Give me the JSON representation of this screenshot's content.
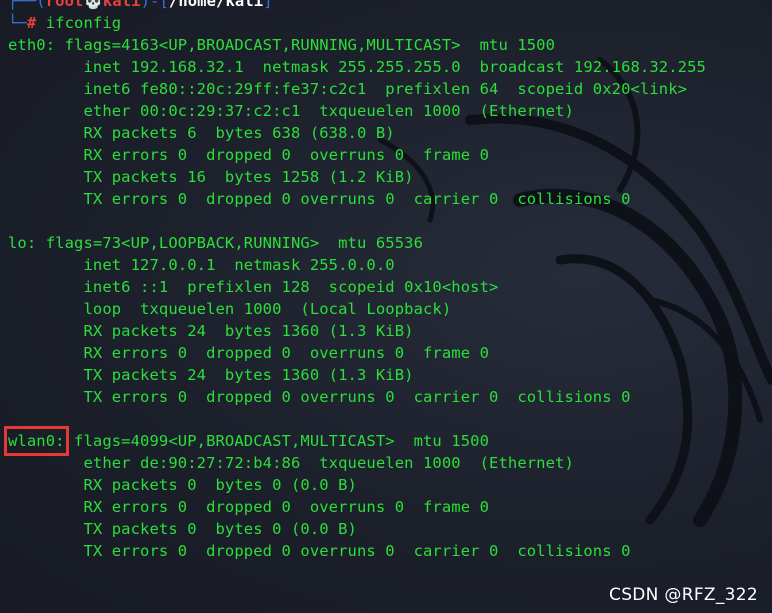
{
  "prompt": {
    "open": "┌──(",
    "user": "root💀kali",
    "mid": ")-[",
    "path": "/home/kali",
    "close": "]",
    "second_prefix": "└─",
    "hash": "#",
    "command": "ifconfig"
  },
  "output": {
    "eth0_header": "eth0: flags=4163<UP,BROADCAST,RUNNING,MULTICAST>  mtu 1500",
    "eth0_lines": [
      "        inet 192.168.32.1  netmask 255.255.255.0  broadcast 192.168.32.255",
      "        inet6 fe80::20c:29ff:fe37:c2c1  prefixlen 64  scopeid 0x20<link>",
      "        ether 00:0c:29:37:c2:c1  txqueuelen 1000  (Ethernet)",
      "        RX packets 6  bytes 638 (638.0 B)",
      "        RX errors 0  dropped 0  overruns 0  frame 0",
      "        TX packets 16  bytes 1258 (1.2 KiB)",
      "        TX errors 0  dropped 0 overruns 0  carrier 0  collisions 0"
    ],
    "lo_header": "lo: flags=73<UP,LOOPBACK,RUNNING>  mtu 65536",
    "lo_lines": [
      "        inet 127.0.0.1  netmask 255.0.0.0",
      "        inet6 ::1  prefixlen 128  scopeid 0x10<host>",
      "        loop  txqueuelen 1000  (Local Loopback)",
      "        RX packets 24  bytes 1360 (1.3 KiB)",
      "        RX errors 0  dropped 0  overruns 0  frame 0",
      "        TX packets 24  bytes 1360 (1.3 KiB)",
      "        TX errors 0  dropped 0 overruns 0  carrier 0  collisions 0"
    ],
    "wlan0_name": "wlan0:",
    "wlan0_header_rest": " flags=4099<UP,BROADCAST,MULTICAST>  mtu 1500",
    "wlan0_lines": [
      "        ether de:90:27:72:b4:86  txqueuelen 1000  (Ethernet)",
      "        RX packets 0  bytes 0 (0.0 B)",
      "        RX errors 0  dropped 0  overruns 0  frame 0",
      "        TX packets 0  bytes 0 (0.0 B)",
      "        TX errors 0  dropped 0 overruns 0  carrier 0  collisions 0"
    ]
  },
  "watermark": "CSDN @RFZ_322",
  "colors": {
    "output_green": "#2bde3a",
    "prompt_red": "#e8413a",
    "prompt_blue": "#3a6fd8",
    "highlight_red": "#e53935",
    "background": "#1c202b"
  }
}
